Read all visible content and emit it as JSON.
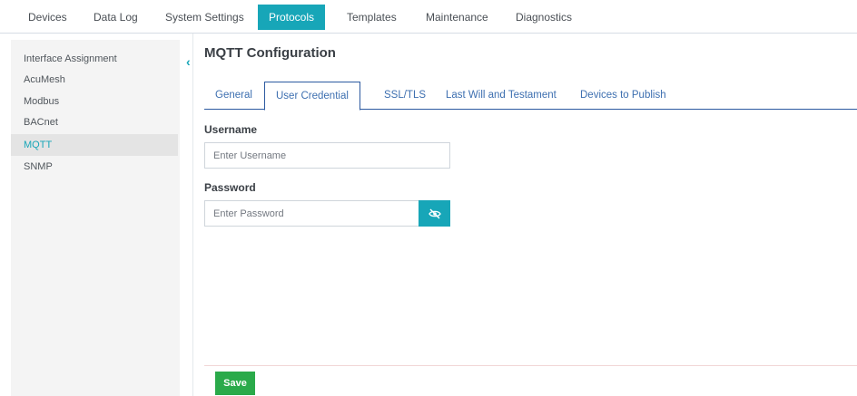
{
  "topnav": {
    "tabs": [
      {
        "label": "Devices"
      },
      {
        "label": "Data Log"
      },
      {
        "label": "System Settings"
      },
      {
        "label": "Protocols",
        "active": true
      },
      {
        "label": "Templates"
      },
      {
        "label": "Maintenance"
      },
      {
        "label": "Diagnostics"
      }
    ]
  },
  "sidebar": {
    "items": [
      {
        "label": "Interface Assignment"
      },
      {
        "label": "AcuMesh"
      },
      {
        "label": "Modbus"
      },
      {
        "label": "BACnet"
      },
      {
        "label": "MQTT",
        "active": true
      },
      {
        "label": "SNMP"
      }
    ],
    "collapse_icon": "chevron-left-icon"
  },
  "main": {
    "title": "MQTT Configuration",
    "tabs": [
      {
        "label": "General"
      },
      {
        "label": "User Credential",
        "active": true
      },
      {
        "label": "SSL/TLS"
      },
      {
        "label": "Last Will and Testament"
      },
      {
        "label": "Devices to Publish"
      }
    ],
    "username": {
      "label": "Username",
      "placeholder": "Enter Username",
      "value": ""
    },
    "password": {
      "label": "Password",
      "placeholder": "Enter Password",
      "value": "",
      "toggle_icon": "eye-slash-icon"
    },
    "save_label": "Save"
  },
  "colors": {
    "accent": "#17a6b8",
    "tab_blue": "#3d6fb0",
    "save_green": "#2aaa4a"
  }
}
